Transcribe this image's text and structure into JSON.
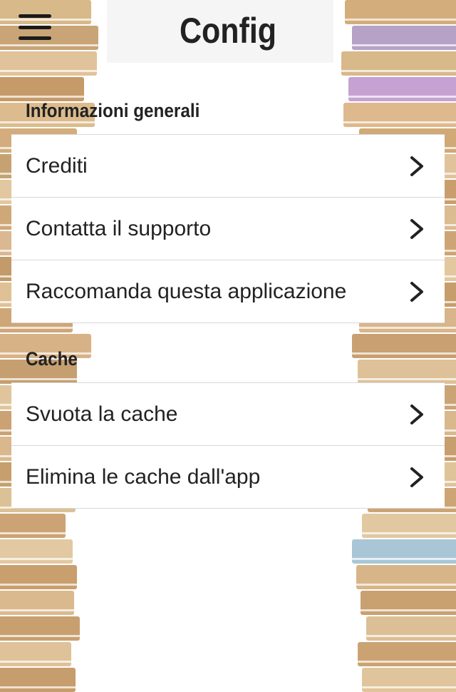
{
  "header": {
    "title": "Config",
    "menu_icon": "hamburger-menu-icon"
  },
  "sections": [
    {
      "title": "Informazioni generali",
      "items": [
        {
          "label": "Crediti",
          "icon": "chevron-right-icon"
        },
        {
          "label": "Contatta il supporto",
          "icon": "chevron-right-icon"
        },
        {
          "label": "Raccomanda questa applicazione",
          "icon": "chevron-right-icon"
        }
      ]
    },
    {
      "title": "Cache",
      "items": [
        {
          "label": "Svuota la cache",
          "icon": "chevron-right-icon"
        },
        {
          "label": "Elimina le cache dall'app",
          "icon": "chevron-right-icon"
        }
      ]
    }
  ],
  "colors": {
    "text": "#222222",
    "divider": "#d8d8d8",
    "background": "#ffffff",
    "header_background": "#f5f5f5"
  }
}
